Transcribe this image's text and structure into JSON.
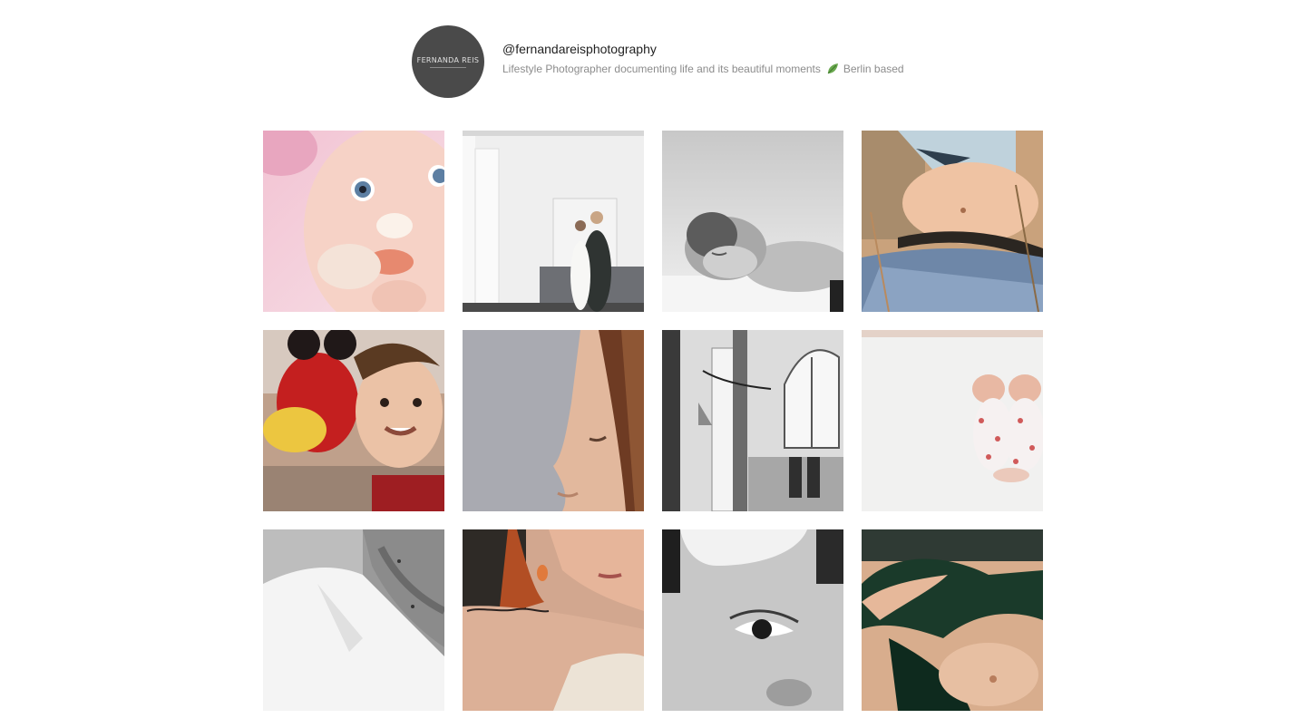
{
  "profile": {
    "avatar_text": "FERNANDA REIS",
    "handle": "@fernandareisphotography",
    "bio_before_icon": "Lifestyle Photographer documenting life and its beautiful moments",
    "bio_icon": "leaf-icon",
    "bio_after_icon": "Berlin based"
  },
  "gallery": {
    "posts": [
      {
        "name": "post-baby-cake-face"
      },
      {
        "name": "post-wedding-couple-hallway"
      },
      {
        "name": "post-sleeping-newborn"
      },
      {
        "name": "post-pregnant-belly-field"
      },
      {
        "name": "post-smiling-baby-minnie"
      },
      {
        "name": "post-woman-profile"
      },
      {
        "name": "post-room-doorway"
      },
      {
        "name": "post-newborn-twins"
      },
      {
        "name": "post-man-white-shirt"
      },
      {
        "name": "post-woman-shoulder-tattoo"
      },
      {
        "name": "post-child-eye-closeup"
      },
      {
        "name": "post-pregnant-belly-hand"
      }
    ]
  }
}
